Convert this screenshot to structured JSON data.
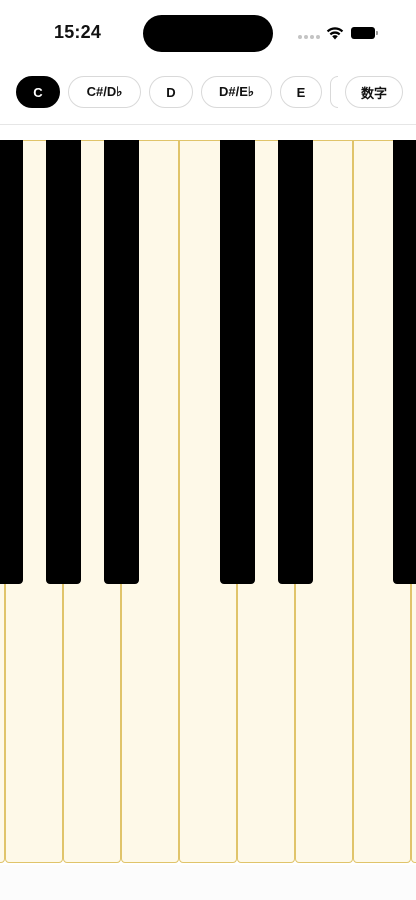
{
  "status_bar": {
    "time": "15:24"
  },
  "key_selector": {
    "selected": "C",
    "chips": [
      {
        "label": "C",
        "active": true
      },
      {
        "label": "C#/D♭",
        "active": false
      },
      {
        "label": "D",
        "active": false
      },
      {
        "label": "D#/E♭",
        "active": false
      },
      {
        "label": "E",
        "active": false
      },
      {
        "label": "",
        "active": false
      },
      {
        "label": "数字",
        "active": false
      }
    ]
  },
  "piano": {
    "white_key_color": "#fef9e8",
    "white_key_border": "#e0c46a",
    "black_key_color": "#000000"
  }
}
